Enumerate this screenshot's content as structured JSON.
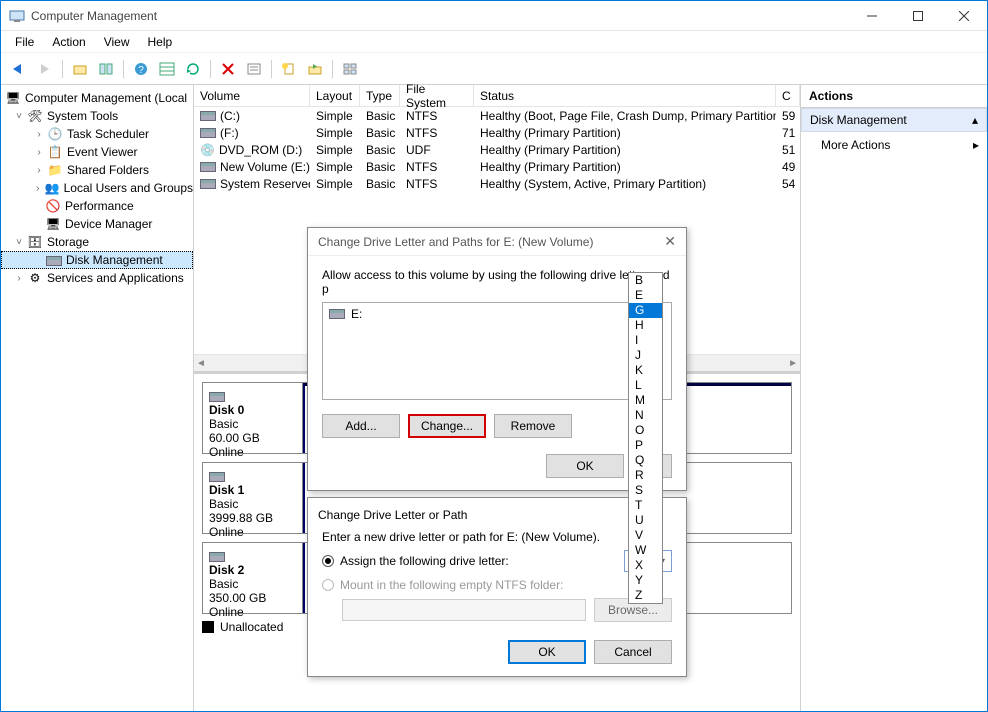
{
  "window": {
    "title": "Computer Management",
    "menus": [
      "File",
      "Action",
      "View",
      "Help"
    ]
  },
  "tree": {
    "root": "Computer Management (Local",
    "system_tools": "System Tools",
    "task_scheduler": "Task Scheduler",
    "event_viewer": "Event Viewer",
    "shared_folders": "Shared Folders",
    "local_users": "Local Users and Groups",
    "performance": "Performance",
    "device_manager": "Device Manager",
    "storage": "Storage",
    "disk_management": "Disk Management",
    "services_apps": "Services and Applications"
  },
  "volumes": {
    "headers": [
      "Volume",
      "Layout",
      "Type",
      "File System",
      "Status",
      "C"
    ],
    "rows": [
      {
        "vol": "(C:)",
        "layout": "Simple",
        "type": "Basic",
        "fs": "NTFS",
        "status": "Healthy (Boot, Page File, Crash Dump, Primary Partition)",
        "c": "59"
      },
      {
        "vol": "(F:)",
        "layout": "Simple",
        "type": "Basic",
        "fs": "NTFS",
        "status": "Healthy (Primary Partition)",
        "c": "71"
      },
      {
        "vol": "DVD_ROM (D:)",
        "layout": "Simple",
        "type": "Basic",
        "fs": "UDF",
        "status": "Healthy (Primary Partition)",
        "c": "51"
      },
      {
        "vol": "New Volume (E:)",
        "layout": "Simple",
        "type": "Basic",
        "fs": "NTFS",
        "status": "Healthy (Primary Partition)",
        "c": "49"
      },
      {
        "vol": "System Reserved",
        "layout": "Simple",
        "type": "Basic",
        "fs": "NTFS",
        "status": "Healthy (System, Active, Primary Partition)",
        "c": "54"
      }
    ]
  },
  "disks": [
    {
      "name": "Disk 0",
      "type": "Basic",
      "size": "60.00 GB",
      "state": "Online"
    },
    {
      "name": "Disk 1",
      "type": "Basic",
      "size": "3999.88 GB",
      "state": "Online"
    },
    {
      "name": "Disk 2",
      "type": "Basic",
      "size": "350.00 GB",
      "state": "Online"
    }
  ],
  "disk_legend": "Unallocated",
  "actions": {
    "header": "Actions",
    "sub": "Disk Management",
    "more": "More Actions"
  },
  "dialog1": {
    "title": "Change Drive Letter and Paths for E: (New Volume)",
    "intro": "Allow access to this volume by using the following drive letter and p",
    "entry": "E:",
    "add": "Add...",
    "change": "Change...",
    "remove": "Remove",
    "ok": "OK",
    "cancel": "Ca"
  },
  "dialog2": {
    "title": "Change Drive Letter or Path",
    "intro": "Enter a new drive letter or path for E: (New Volume).",
    "opt_assign": "Assign the following drive letter:",
    "opt_mount": "Mount in the following empty NTFS folder:",
    "browse": "Browse...",
    "ok": "OK",
    "cancel": "Cancel",
    "selected_letter": "G"
  },
  "dropdown": {
    "items": [
      "B",
      "E",
      "G",
      "H",
      "I",
      "J",
      "K",
      "L",
      "M",
      "N",
      "O",
      "P",
      "Q",
      "R",
      "S",
      "T",
      "U",
      "V",
      "W",
      "X",
      "Y",
      "Z"
    ],
    "selected": "G"
  }
}
